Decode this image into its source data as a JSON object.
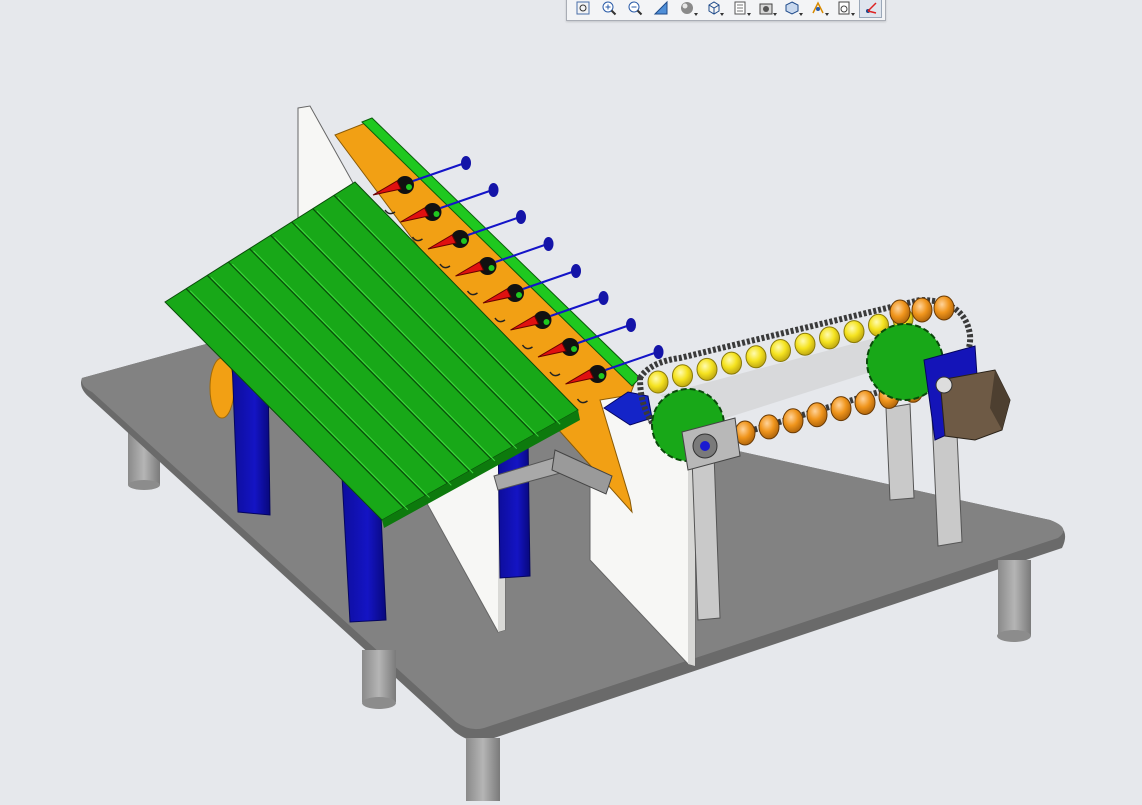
{
  "app": {
    "background": "#e6e8ec",
    "viewport_label": ""
  },
  "toolbar": {
    "buttons": [
      {
        "name": "zoom-to-fit-button",
        "icon": "zoom-to-fit-icon",
        "has_dropdown": false
      },
      {
        "name": "zoom-in-button",
        "icon": "zoom-in-icon",
        "has_dropdown": false
      },
      {
        "name": "zoom-out-button",
        "icon": "zoom-out-icon",
        "has_dropdown": false
      },
      {
        "name": "section-view-button",
        "icon": "section-view-icon",
        "has_dropdown": false
      },
      {
        "name": "display-style-button",
        "icon": "display-style-icon",
        "has_dropdown": true
      },
      {
        "name": "view-orientation-button",
        "icon": "view-orientation-icon",
        "has_dropdown": true
      },
      {
        "name": "hide-show-items-button",
        "icon": "hide-show-icon",
        "has_dropdown": true
      },
      {
        "name": "edit-appearance-button",
        "icon": "edit-appearance-icon",
        "has_dropdown": true
      },
      {
        "name": "apply-scene-button",
        "icon": "apply-scene-icon",
        "has_dropdown": true
      },
      {
        "name": "view-settings-button",
        "icon": "view-settings-icon",
        "has_dropdown": true
      },
      {
        "name": "display-pane-button",
        "icon": "display-pane-icon",
        "has_dropdown": true
      },
      {
        "name": "view-triad-button",
        "icon": "view-triad-icon",
        "has_dropdown": false,
        "active": true
      }
    ]
  },
  "model": {
    "colors": {
      "base_plate": "#7f7f7f",
      "leg": "#9b9b9b",
      "panel": "#f7f7f5",
      "post_blue": "#0a0aa8",
      "tray_green": "#1fa81f",
      "rail_orange": "#f2a014",
      "bearing": "#e3a02b",
      "roller_yellow": "#f5e320",
      "roller_orange": "#f0951c",
      "pointer_red": "#e01010",
      "motor": "#6e5a45",
      "frame_grey": "#c9c9c9"
    }
  }
}
